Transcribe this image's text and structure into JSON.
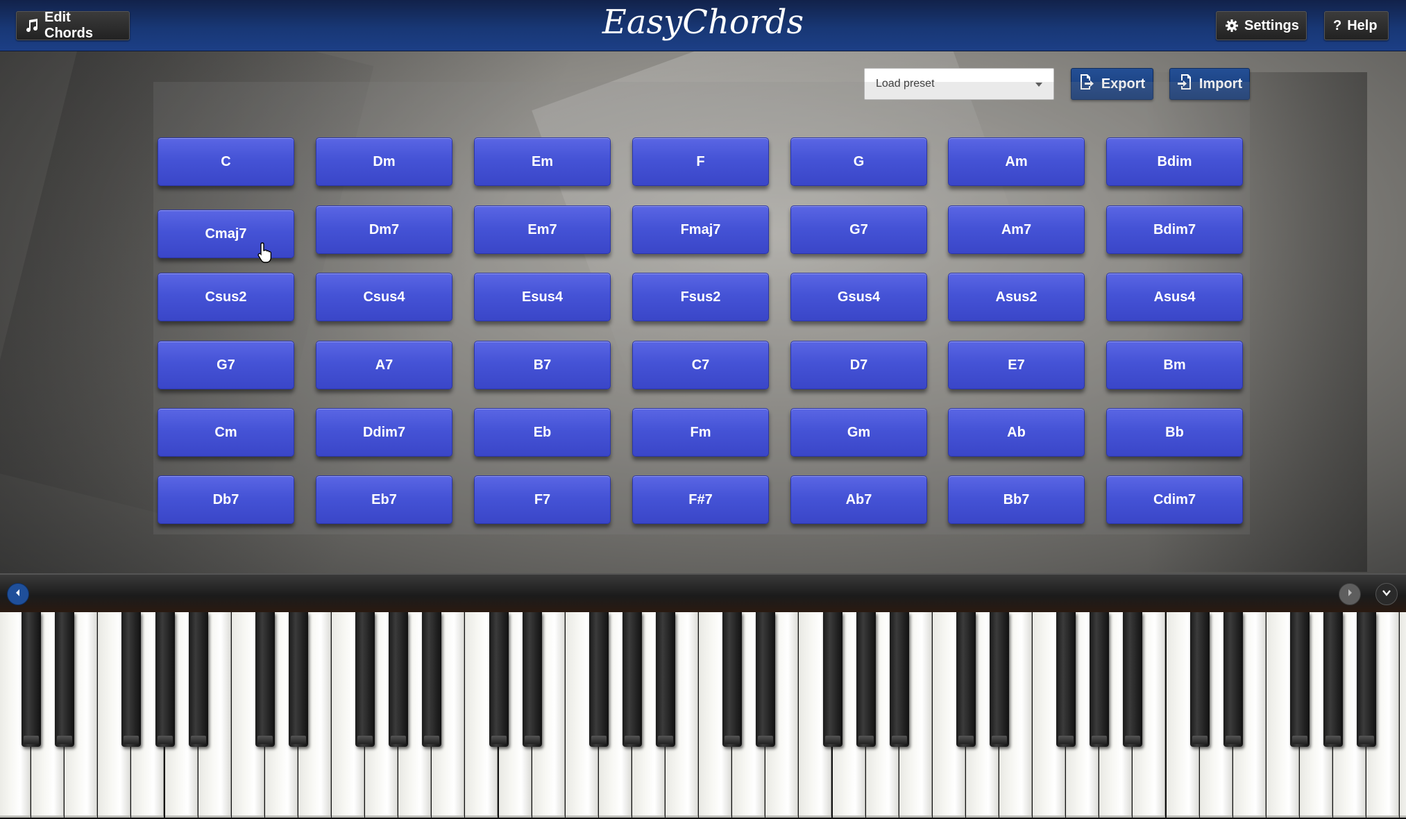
{
  "header": {
    "edit_chords_label": "Edit Chords",
    "app_title": "EasyChords",
    "settings_label": "Settings",
    "help_label": "Help",
    "icons": {
      "edit": "music-note-icon",
      "settings": "gear-icon",
      "help": "question-mark-icon"
    }
  },
  "toolbar": {
    "preset_placeholder": "Load preset",
    "export_label": "Export",
    "import_label": "Import"
  },
  "chords": [
    [
      "C",
      "Dm",
      "Em",
      "F",
      "G",
      "Am",
      "Bdim"
    ],
    [
      "Cmaj7",
      "Dm7",
      "Em7",
      "Fmaj7",
      "G7",
      "Am7",
      "Bdim7"
    ],
    [
      "Csus2",
      "Csus4",
      "Esus4",
      "Fsus2",
      "Gsus4",
      "Asus2",
      "Asus4"
    ],
    [
      "G7",
      "A7",
      "B7",
      "C7",
      "D7",
      "E7",
      "Bm"
    ],
    [
      "Cm",
      "Ddim7",
      "Eb",
      "Fm",
      "Gm",
      "Ab",
      "Bb"
    ],
    [
      "Db7",
      "Eb7",
      "F7",
      "F#7",
      "Ab7",
      "Bb7",
      "Cdim7"
    ]
  ],
  "colors": {
    "header_bg": "#183775",
    "chord_button": "#4553d6",
    "action_button": "#1f4791"
  },
  "piano": {
    "nav_left": "chevron-left-icon",
    "nav_right": "chevron-right-icon",
    "collapse": "chevron-down-icon"
  }
}
